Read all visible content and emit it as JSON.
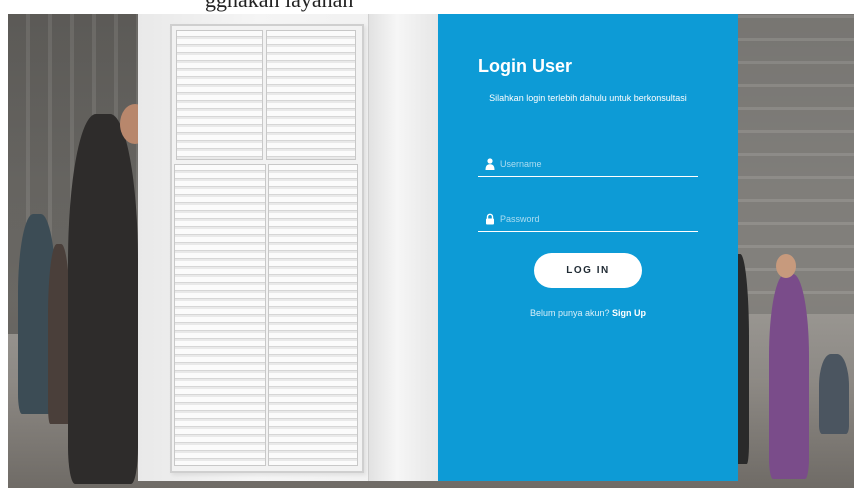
{
  "cropped_caption": "ggnakan layanan",
  "login": {
    "title": "Login User",
    "subtitle": "Silahkan login terlebih dahulu untuk berkonsultasi",
    "username_placeholder": "Username",
    "password_placeholder": "Password",
    "button_label": "LOG IN",
    "signup_prompt": "Belum punya akun?",
    "signup_link": "Sign Up"
  },
  "icons": {
    "username": "user-icon",
    "password": "lock-icon"
  },
  "colors": {
    "panel": "#0d9bd6",
    "button_bg": "#ffffff",
    "button_text": "#1f2a33",
    "text": "#ffffff"
  }
}
